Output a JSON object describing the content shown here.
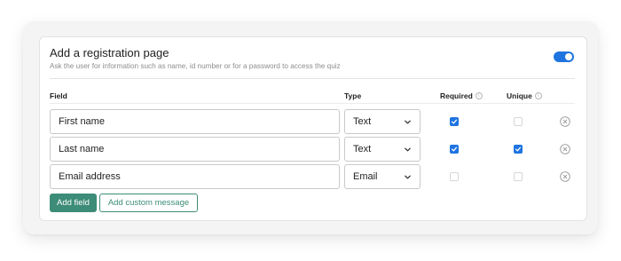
{
  "section": {
    "title": "Add a registration page",
    "subtitle": "Ask the user for information such as name, id number or for a password to access the quiz",
    "toggle_on": true,
    "accent_color": "#1f74e0"
  },
  "table": {
    "headers": {
      "field": "Field",
      "type": "Type",
      "required": "Required",
      "unique": "Unique"
    },
    "info_glyph": "i",
    "rows": [
      {
        "field": "First name",
        "type": "Text",
        "required": true,
        "unique": false
      },
      {
        "field": "Last name",
        "type": "Text",
        "required": true,
        "unique": true
      },
      {
        "field": "Email address",
        "type": "Email",
        "required": false,
        "unique": false
      }
    ]
  },
  "actions": {
    "add_field": "Add field",
    "add_custom_message": "Add custom message",
    "button_color": "#3d8c77"
  },
  "icons": {
    "toggle": "toggle-switch-icon",
    "info": "info-circle-icon",
    "chevron": "chevron-down-icon",
    "remove": "close-circle-icon",
    "check": "checkmark-icon"
  }
}
